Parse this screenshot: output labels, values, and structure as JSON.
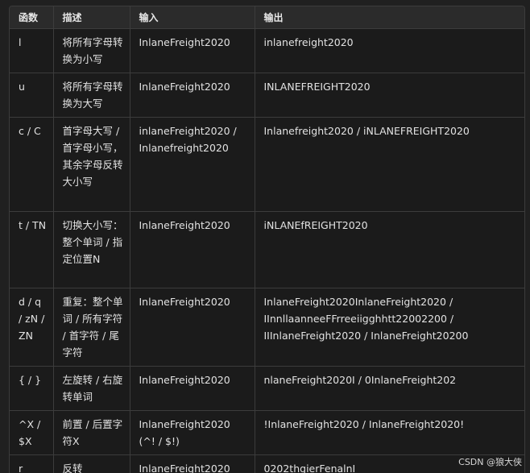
{
  "table": {
    "headers": [
      "函数",
      "描述",
      "输入",
      "输出"
    ],
    "rows": [
      [
        "l",
        "将所有字母转换为小写",
        "InlaneFreight2020",
        "inlanefreight2020"
      ],
      [
        "u",
        "将所有字母转换为大写",
        "InlaneFreight2020",
        "INLANEFREIGHT2020"
      ],
      [
        "c / C",
        "首字母大写 / 首字母小写，其余字母反转大小写",
        "inlaneFreight2020 / Inlanefreight2020",
        "Inlanefreight2020 / iNLANEFREIGHT2020"
      ],
      [
        "t / TN",
        "切换大小写：整个单词 / 指定位置N",
        "InlaneFreight2020",
        "iNLANEfREIGHT2020"
      ],
      [
        "d / q / zN / ZN",
        "重复：整个单词 / 所有字符 / 首字符 / 尾字符",
        "InlaneFreight2020",
        "InlaneFreight2020InlaneFreight2020 / IInnllaanneeFFrreeiigghhtt22002200 / IIInlaneFreight2020 / InlaneFreight20200"
      ],
      [
        "{ / }",
        "左旋转 / 右旋转单词",
        "InlaneFreight2020",
        "nlaneFreight2020I / 0InlaneFreight202"
      ],
      [
        "^X / $X",
        "前置 / 后置字符X",
        "InlaneFreight2020 (^! / $!)",
        "!InlaneFreight2020 / InlaneFreight2020!"
      ],
      [
        "r",
        "反转",
        "InlaneFreight2020",
        "0202thgierFenalnI"
      ]
    ]
  },
  "watermark": "CSDN @狼大侠"
}
